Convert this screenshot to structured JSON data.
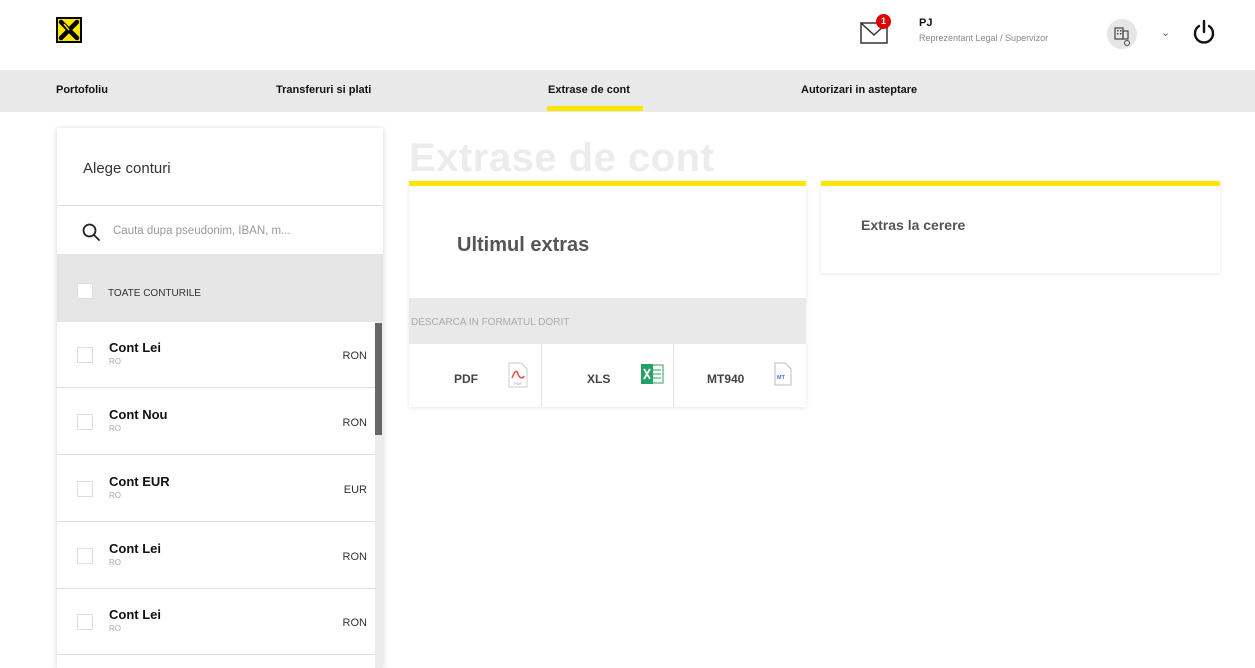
{
  "header": {
    "mail_badge": "1",
    "user_initials": "PJ",
    "user_role": "Reprezentant Legal / Supervizor"
  },
  "nav": {
    "items": [
      {
        "label": "Portofoliu"
      },
      {
        "label": "Transferuri si plati"
      },
      {
        "label": "Extrase de cont"
      },
      {
        "label": "Autorizari in asteptare"
      }
    ],
    "active_index": 2
  },
  "accounts_panel": {
    "title": "Alege conturi",
    "search_placeholder": "Cauta dupa pseudonim, IBAN, m...",
    "all_label": "TOATE CONTURILE",
    "accounts": [
      {
        "name": "Cont Lei",
        "iban": "RO",
        "currency": "RON"
      },
      {
        "name": "Cont Nou",
        "iban": "RO",
        "currency": "RON"
      },
      {
        "name": "Cont EUR",
        "iban": "RO",
        "currency": "EUR"
      },
      {
        "name": "Cont Lei",
        "iban": "RO",
        "currency": "RON"
      },
      {
        "name": "Cont Lei",
        "iban": "RO",
        "currency": "RON"
      }
    ]
  },
  "main": {
    "page_title": "Extrase de cont",
    "last_statement": {
      "title": "Ultimul extras",
      "download_label": "DESCARCA IN FORMATUL DORIT",
      "formats": [
        {
          "label": "PDF",
          "icon": "pdf-file-icon"
        },
        {
          "label": "XLS",
          "icon": "excel-file-icon"
        },
        {
          "label": "MT940",
          "icon": "mt940-file-icon"
        }
      ]
    },
    "on_demand": {
      "title": "Extras la cerere"
    }
  },
  "colors": {
    "accent": "#fee600",
    "nav_bg": "#e9e9e9",
    "badge": "#e00000"
  }
}
